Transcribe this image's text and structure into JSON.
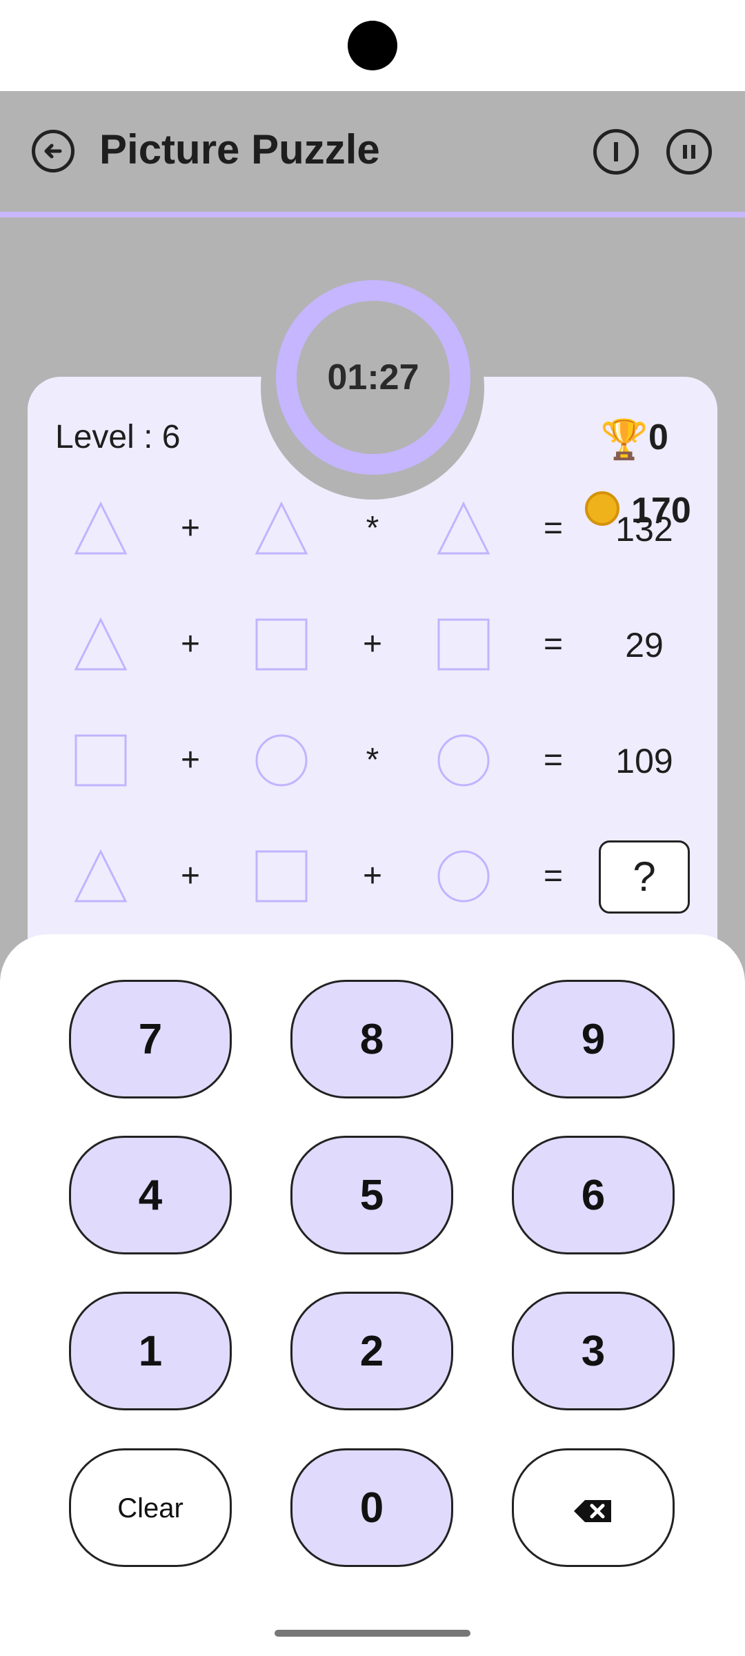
{
  "app": {
    "title": "Picture Puzzle"
  },
  "timer": {
    "text": "01:27"
  },
  "stats": {
    "level_text": "Level : 6",
    "trophies": "0",
    "coins": "170"
  },
  "equations": [
    {
      "ops": [
        "+",
        "*"
      ],
      "equals": "=",
      "result": "132"
    },
    {
      "ops": [
        "+",
        "+"
      ],
      "equals": "=",
      "result": "29"
    },
    {
      "ops": [
        "+",
        "*"
      ],
      "equals": "=",
      "result": "109"
    },
    {
      "ops": [
        "+",
        "+"
      ],
      "equals": "=",
      "result": "?"
    }
  ],
  "keypad": {
    "keys": [
      "7",
      "8",
      "9",
      "4",
      "5",
      "6",
      "1",
      "2",
      "3",
      "Clear",
      "0"
    ],
    "backspace_icon": "backspace-icon"
  },
  "icons": {
    "back": "back-arrow-icon",
    "info": "info-icon",
    "pause": "pause-icon",
    "trophy": "trophy-icon",
    "coin": "coin-icon"
  },
  "colors": {
    "accent": "#c5b6ff",
    "card_bg": "#efecfd",
    "key_bg": "#e0dafd",
    "overlay": "#b3b3b3"
  }
}
